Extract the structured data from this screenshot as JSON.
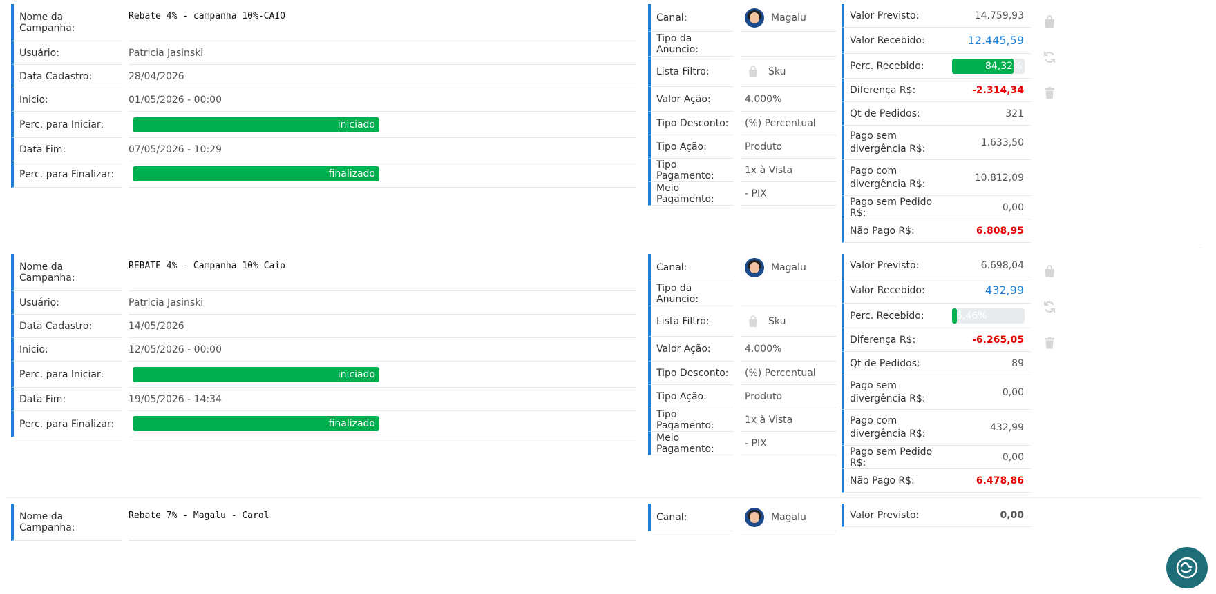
{
  "campaigns": [
    {
      "name": "Rebate 4% - campanha 10%-CAIO",
      "user": "Patricia Jasinski",
      "created": "28/04/2026",
      "start": "01/05/2026 - 00:00",
      "start_status": "iniciado",
      "end": "07/05/2026 - 10:29",
      "end_status": "finalizado",
      "channel": "Magalu",
      "ad_type": "",
      "filter_list": "Sku",
      "action_value": "4.000%",
      "discount_type": "(%) Percentual",
      "action_type": "Produto",
      "payment_type": "1x à Vista",
      "payment_method": "- PIX",
      "expected": "14.759,93",
      "received": "12.445,59",
      "received_pct": "84,32%",
      "received_frac": 0.8432,
      "difference": "-2.314,34",
      "orders": "321",
      "paid_no_div": "1.633,50",
      "paid_div": "10.812,09",
      "paid_no_order": "0,00",
      "not_paid": "6.808,95"
    },
    {
      "name": "REBATE 4% - Campanha 10% Caio",
      "user": "Patricia Jasinski",
      "created": "14/05/2026",
      "start": "12/05/2026 - 00:00",
      "start_status": "iniciado",
      "end": "19/05/2026 - 14:34",
      "end_status": "finalizado",
      "channel": "Magalu",
      "ad_type": "",
      "filter_list": "Sku",
      "action_value": "4.000%",
      "discount_type": "(%) Percentual",
      "action_type": "Produto",
      "payment_type": "1x à Vista",
      "payment_method": "- PIX",
      "expected": "6.698,04",
      "received": "432,99",
      "received_pct": "6,46%",
      "received_frac": 0.0646,
      "difference": "-6.265,05",
      "orders": "89",
      "paid_no_div": "0,00",
      "paid_div": "432,99",
      "paid_no_order": "0,00",
      "not_paid": "6.478,86"
    },
    {
      "name": "Rebate 7% - Magalu - Carol",
      "channel": "Magalu",
      "expected": "0,00"
    }
  ],
  "labels": {
    "name": "Nome da Campanha:",
    "user": "Usuário:",
    "created": "Data Cadastro:",
    "start": "Inicio:",
    "start_pct": "Perc. para Iniciar:",
    "end": "Data Fim:",
    "end_pct": "Perc. para Finalizar:",
    "channel": "Canal:",
    "ad_type": "Tipo da Anuncio:",
    "filter_list": "Lista Filtro:",
    "action_value": "Valor Ação:",
    "discount_type": "Tipo Desconto:",
    "action_type": "Tipo Ação:",
    "payment_type": "Tipo Pagamento:",
    "payment_method": "Meio Pagamento:",
    "expected": "Valor Previsto:",
    "received": "Valor Recebido:",
    "received_pct": "Perc. Recebido:",
    "difference": "Diferença R$:",
    "orders": "Qt de Pedidos:",
    "paid_no_div_1": "Pago sem",
    "paid_no_div_2": "divergência R$:",
    "paid_div_1": "Pago com",
    "paid_div_2": "divergência R$:",
    "paid_no_order": "Pago sem Pedido R$:",
    "not_paid": "Não Pago R$:"
  },
  "colors": {
    "accent": "#1e7fd6",
    "success": "#00b04f",
    "danger": "#e60000"
  },
  "icons": {
    "bag": "shopping-bag-icon",
    "refresh": "refresh-icon",
    "trash": "trash-icon",
    "chat": "chat-assistant-icon"
  }
}
